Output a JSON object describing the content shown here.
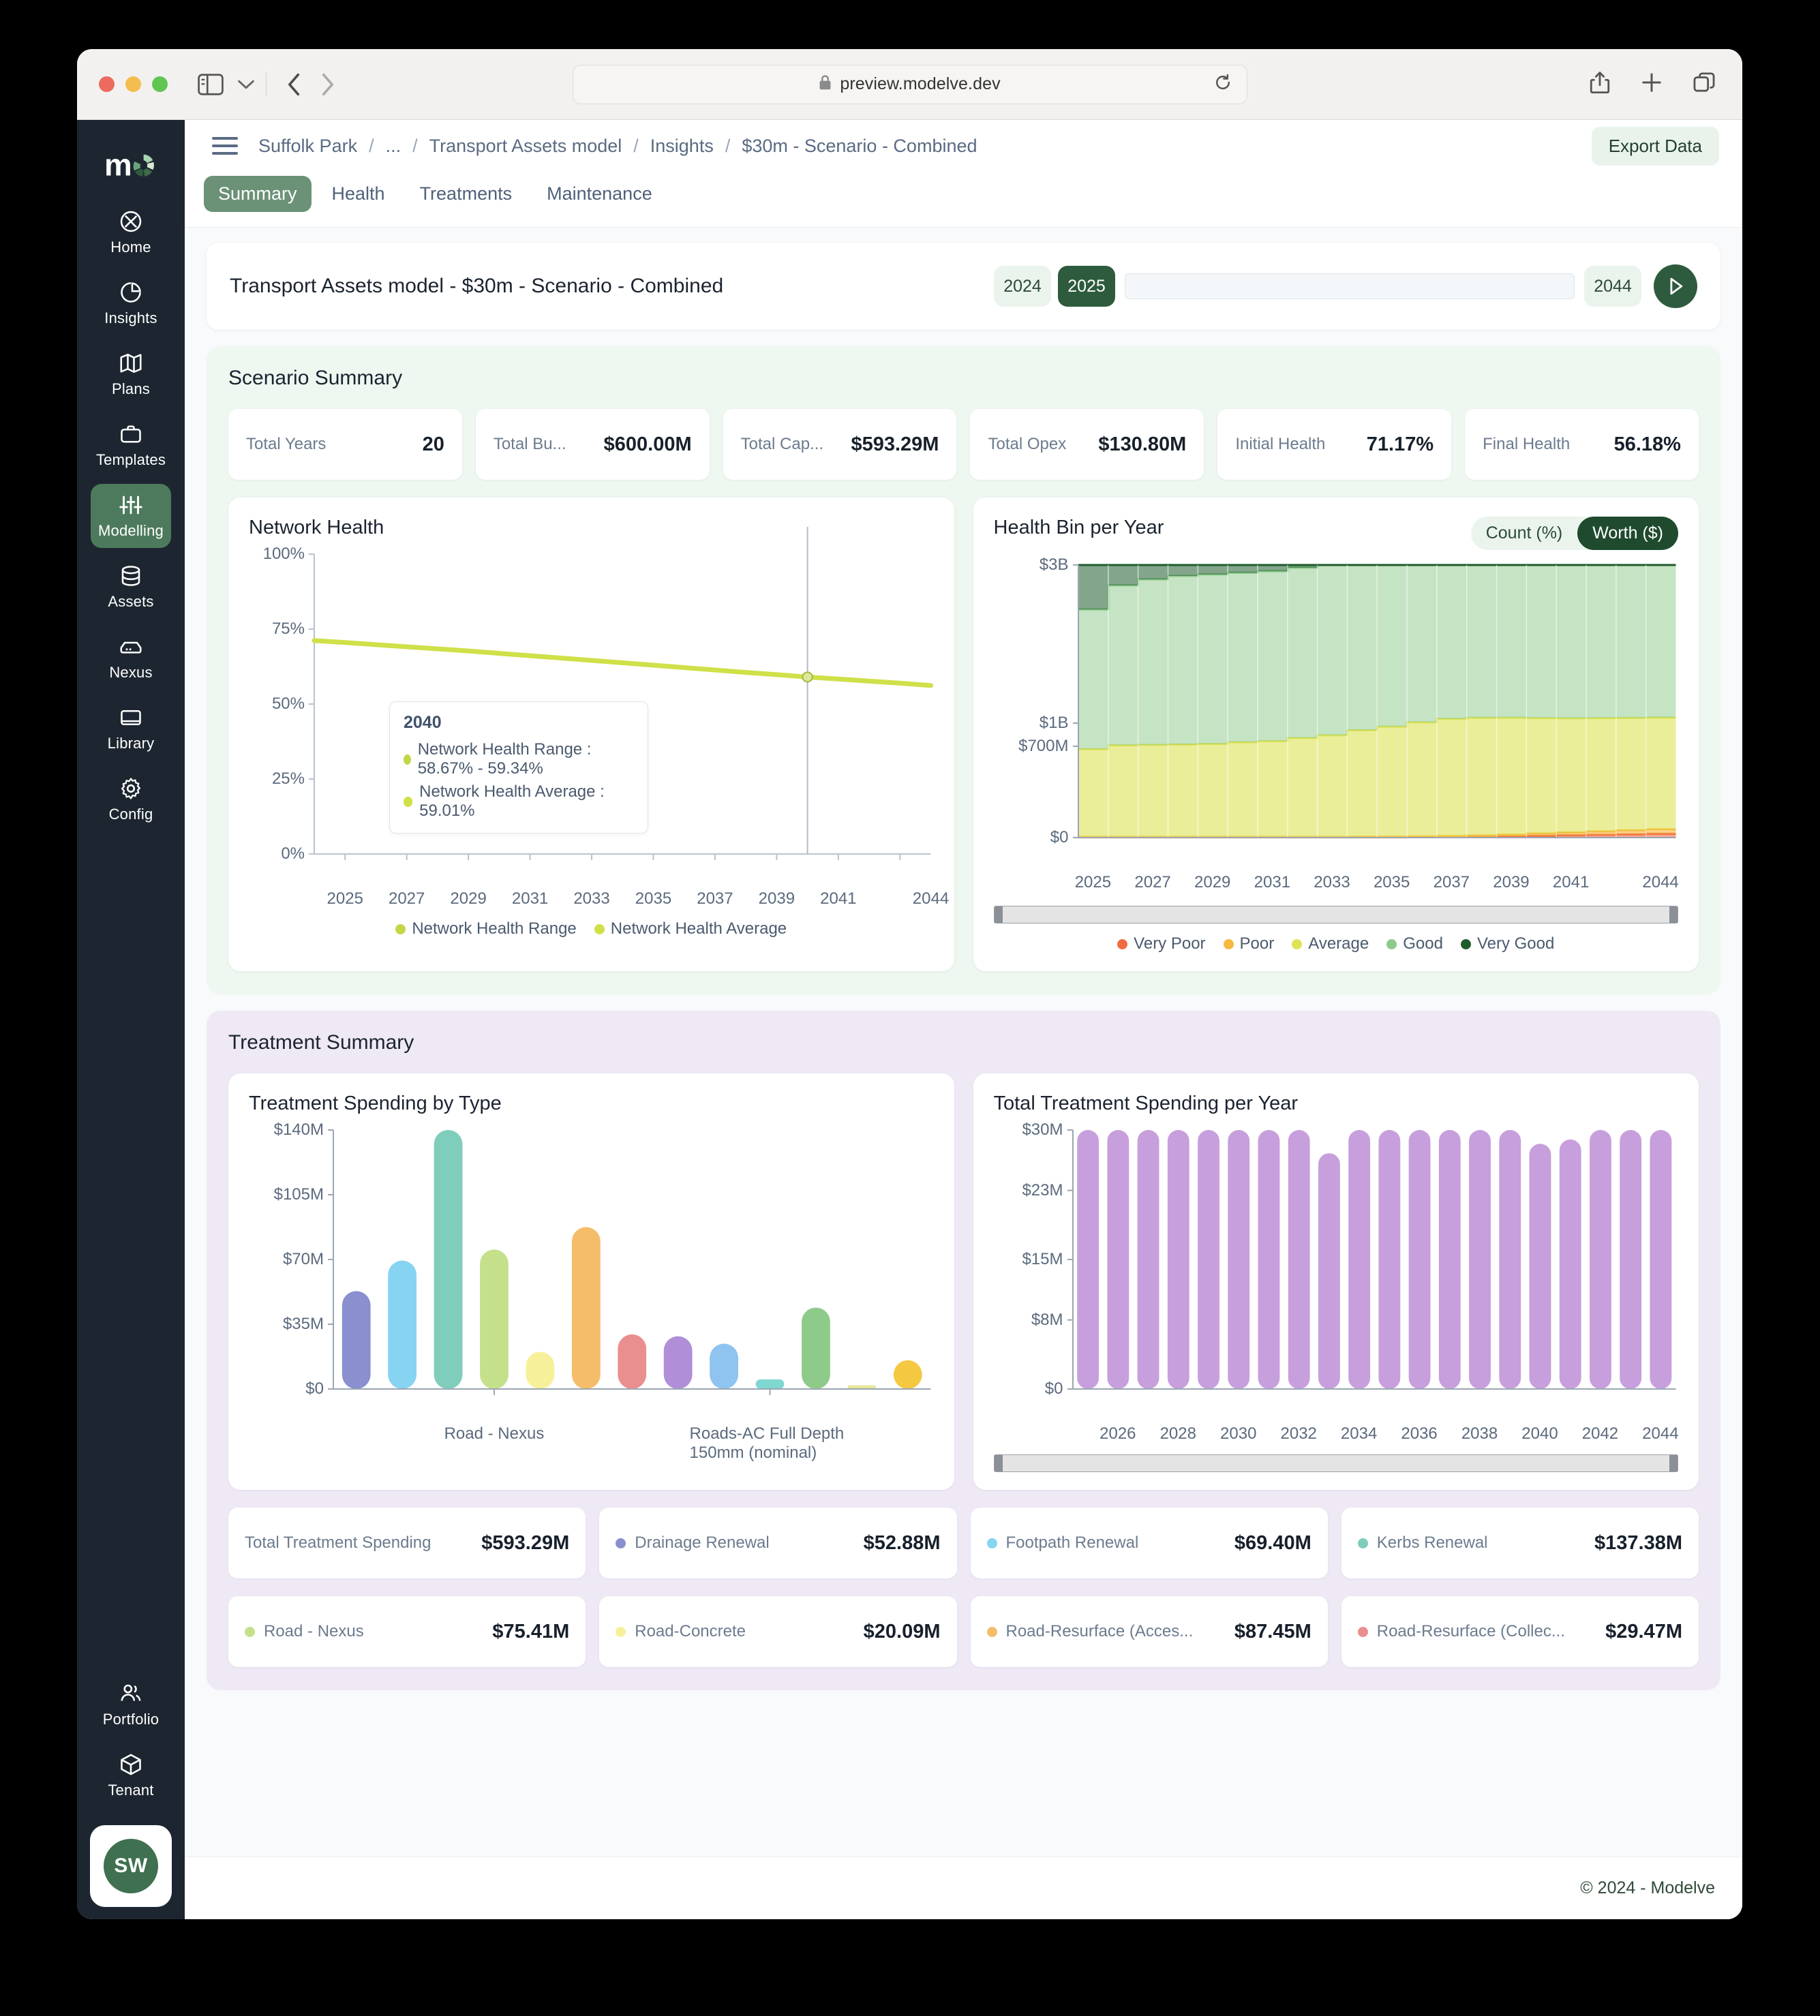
{
  "browser": {
    "url": "preview.modelve.dev",
    "lock_icon": "lock-icon",
    "reload_icon": "reload-icon",
    "share_icon": "share-icon",
    "new_tab_icon": "plus-icon",
    "tabs_icon": "tabs-overview-icon",
    "back_icon": "chevron-left-icon",
    "forward_icon": "chevron-right-icon",
    "sidebar_icon": "sidebar-toggle-icon",
    "sidebar_chevron": "chevron-down-icon"
  },
  "rail": {
    "logo": "modelve-logo",
    "items": [
      {
        "label": "Home",
        "icon": "home-aperture-icon",
        "active": false
      },
      {
        "label": "Insights",
        "icon": "pie-chart-icon",
        "active": false
      },
      {
        "label": "Plans",
        "icon": "map-icon",
        "active": false
      },
      {
        "label": "Templates",
        "icon": "briefcase-icon",
        "active": false
      },
      {
        "label": "Modelling",
        "icon": "sliders-icon",
        "active": true
      },
      {
        "label": "Assets",
        "icon": "database-icon",
        "active": false
      },
      {
        "label": "Nexus",
        "icon": "server-icon",
        "active": false
      },
      {
        "label": "Library",
        "icon": "book-icon",
        "active": false
      },
      {
        "label": "Config",
        "icon": "gear-icon",
        "active": false
      }
    ],
    "bottom_items": [
      {
        "label": "Portfolio",
        "icon": "users-icon"
      },
      {
        "label": "Tenant",
        "icon": "cube-icon"
      }
    ],
    "avatar_initials": "SW"
  },
  "topbar": {
    "menu_icon": "hamburger-icon",
    "breadcrumb": [
      "Suffolk Park",
      "...",
      "Transport Assets model",
      "Insights",
      "$30m - Scenario - Combined"
    ],
    "export_label": "Export Data"
  },
  "tabs": [
    {
      "label": "Summary",
      "active": true
    },
    {
      "label": "Health",
      "active": false
    },
    {
      "label": "Treatments",
      "active": false
    },
    {
      "label": "Maintenance",
      "active": false
    }
  ],
  "title_bar": {
    "title": "Transport Assets model - $30m - Scenario - Combined",
    "start_year": "2024",
    "current_year": "2025",
    "end_year": "2044",
    "play_icon": "play-icon"
  },
  "scenario_summary": {
    "heading": "Scenario Summary",
    "stats": [
      {
        "label": "Total Years",
        "value": "20"
      },
      {
        "label": "Total Bu...",
        "value": "$600.00M"
      },
      {
        "label": "Total Cap...",
        "value": "$593.29M"
      },
      {
        "label": "Total Opex",
        "value": "$130.80M"
      },
      {
        "label": "Initial Health",
        "value": "71.17%"
      },
      {
        "label": "Final Health",
        "value": "56.18%"
      }
    ]
  },
  "treatment_summary": {
    "heading": "Treatment Summary",
    "cards": [
      {
        "label": "Total Treatment Spending",
        "value": "$593.29M",
        "color": null
      },
      {
        "label": "Drainage Renewal",
        "value": "$52.88M",
        "color": "#8a8fd0"
      },
      {
        "label": "Footpath Renewal",
        "value": "$69.40M",
        "color": "#87d3f2"
      },
      {
        "label": "Kerbs Renewal",
        "value": "$137.38M",
        "color": "#7fcdbb"
      },
      {
        "label": "Road - Nexus",
        "value": "$75.41M",
        "color": "#c5e08b"
      },
      {
        "label": "Road-Concrete",
        "value": "$20.09M",
        "color": "#f7f09a"
      },
      {
        "label": "Road-Resurface (Acces...",
        "value": "$87.45M",
        "color": "#f5bc6a"
      },
      {
        "label": "Road-Resurface (Collec...",
        "value": "$29.47M",
        "color": "#e98f8f"
      }
    ]
  },
  "footer": {
    "copyright": "© 2024 - Modelve"
  },
  "chart_data": [
    {
      "id": "network-health",
      "type": "line",
      "title": "Network Health",
      "xlabel": "",
      "ylabel": "",
      "ylim": [
        0,
        100
      ],
      "ytick_labels": [
        "0%",
        "25%",
        "50%",
        "75%",
        "100%"
      ],
      "ytick_values": [
        0,
        25,
        50,
        75,
        100
      ],
      "x": [
        2024,
        2025,
        2026,
        2027,
        2028,
        2029,
        2030,
        2031,
        2032,
        2033,
        2034,
        2035,
        2036,
        2037,
        2038,
        2039,
        2040,
        2041,
        2042,
        2043,
        2044
      ],
      "xtick_labels": [
        "2025",
        "2027",
        "2029",
        "2031",
        "2033",
        "2035",
        "2037",
        "2039",
        "2041",
        "2044"
      ],
      "grid": false,
      "legend": [
        "Network Health Range",
        "Network Health Average"
      ],
      "legend_position": "bottom",
      "series": [
        {
          "name": "Network Health Range",
          "color": "#c4d646",
          "lower": [
            70.6,
            70.0,
            69.3,
            68.6,
            67.9,
            67.2,
            66.4,
            65.6,
            64.8,
            64.0,
            63.2,
            62.4,
            61.6,
            60.8,
            60.0,
            59.3,
            58.67,
            58.0,
            57.3,
            56.6,
            55.8
          ],
          "upper": [
            71.6,
            71.0,
            70.3,
            69.6,
            68.9,
            68.2,
            67.4,
            66.6,
            65.9,
            65.1,
            64.3,
            63.5,
            62.7,
            61.9,
            61.1,
            60.3,
            59.34,
            58.7,
            58.0,
            57.3,
            56.6
          ]
        },
        {
          "name": "Network Health Average",
          "color": "#cfe048",
          "values": [
            71.17,
            70.5,
            69.8,
            69.1,
            68.4,
            67.7,
            66.9,
            66.1,
            65.35,
            64.55,
            63.75,
            62.95,
            62.15,
            61.35,
            60.55,
            59.8,
            59.01,
            58.35,
            57.65,
            56.95,
            56.18
          ]
        }
      ],
      "tooltip": {
        "year": "2040",
        "rows": [
          {
            "label": "Network Health Range : 58.67% - 59.34%",
            "color": "#c4d646"
          },
          {
            "label": "Network Health Average : 59.01%",
            "color": "#cfe048"
          }
        ]
      }
    },
    {
      "id": "health-bin-per-year",
      "type": "area",
      "title": "Health Bin per Year",
      "toggle_options": [
        "Count (%)",
        "Worth ($)"
      ],
      "toggle_selected": "Worth ($)",
      "xlabel": "",
      "ylabel": "",
      "ylim": [
        0,
        3000
      ],
      "ytick_labels": [
        "$0",
        "$700M",
        "$1B",
        "$3B"
      ],
      "ytick_values": [
        0,
        700,
        1000,
        3000
      ],
      "x": [
        2025,
        2026,
        2027,
        2028,
        2029,
        2030,
        2031,
        2032,
        2033,
        2034,
        2035,
        2036,
        2037,
        2038,
        2039,
        2040,
        2041,
        2042,
        2043,
        2044
      ],
      "xtick_labels": [
        "2025",
        "2027",
        "2029",
        "2031",
        "2033",
        "2035",
        "2037",
        "2039",
        "2041",
        "2044"
      ],
      "grid": false,
      "legend": [
        "Very Poor",
        "Poor",
        "Average",
        "Good",
        "Very Good"
      ],
      "legend_position": "bottom",
      "series": [
        {
          "name": "Very Poor",
          "color": "#ef6c42",
          "values": [
            2,
            2,
            2,
            2,
            2,
            2,
            2,
            2,
            2,
            2,
            2,
            3,
            4,
            6,
            9,
            14,
            18,
            22,
            26,
            30
          ]
        },
        {
          "name": "Poor",
          "color": "#f6b83f",
          "values": [
            4,
            4,
            4,
            4,
            4,
            4,
            4,
            4,
            4,
            5,
            6,
            7,
            9,
            11,
            14,
            18,
            22,
            26,
            30,
            34
          ]
        },
        {
          "name": "Average",
          "color": "#dde354",
          "values": [
            672,
            706,
            712,
            716,
            724,
            746,
            760,
            800,
            836,
            900,
            946,
            1000,
            1040,
            1050,
            1045,
            1030,
            1020,
            1014,
            1010,
            1005
          ]
        },
        {
          "name": "Good",
          "color": "#8cc98a",
          "values": [
            1760,
            2030,
            2100,
            2140,
            2150,
            2150,
            2155,
            2160,
            2170,
            2180,
            2190,
            2195,
            2200,
            2205,
            2215,
            2225,
            2230,
            2235,
            2240,
            2245
          ]
        },
        {
          "name": "Very Good",
          "color": "#1e5c2b",
          "values": [
            3000,
            3000,
            3000,
            3000,
            3000,
            3000,
            3000,
            3000,
            3000,
            3000,
            3000,
            3000,
            3000,
            3000,
            3000,
            3000,
            3000,
            3000,
            3000,
            3000
          ]
        }
      ]
    },
    {
      "id": "treatment-spending-by-type",
      "type": "bar",
      "title": "Treatment Spending by Type",
      "xlabel": "",
      "ylabel": "",
      "ylim": [
        0,
        140
      ],
      "ytick_labels": [
        "$0",
        "$35M",
        "$70M",
        "$105M",
        "$140M"
      ],
      "ytick_values": [
        0,
        35,
        70,
        105,
        140
      ],
      "xtick_labels": [
        "Road - Nexus",
        "Roads-AC Full Depth 150mm (nominal)"
      ],
      "grid": false,
      "categories": [
        "b1",
        "b2",
        "b3",
        "b4",
        "b5",
        "b6",
        "b7",
        "b8",
        "b9",
        "b10",
        "b11",
        "b12",
        "b13"
      ],
      "values": [
        52.9,
        69.4,
        140.0,
        75.4,
        20.1,
        87.5,
        29.5,
        28.5,
        24.5,
        5.2,
        44.0,
        2.0,
        15.5
      ],
      "colors": [
        "#8a8fd0",
        "#87d3f2",
        "#7fcdbb",
        "#c5e08b",
        "#f7f09a",
        "#f5bc6a",
        "#e98f8f",
        "#b08fd8",
        "#8fc3f0",
        "#7fd8d0",
        "#8ecb8a",
        "#e8e79a",
        "#f5c842"
      ]
    },
    {
      "id": "total-treatment-spending-per-year",
      "type": "bar",
      "title": "Total Treatment Spending per Year",
      "xlabel": "",
      "ylabel": "",
      "ylim": [
        0,
        30
      ],
      "ytick_labels": [
        "$0",
        "$8M",
        "$15M",
        "$23M",
        "$30M"
      ],
      "ytick_values": [
        0,
        8,
        15,
        23,
        30
      ],
      "categories": [
        2025,
        2026,
        2027,
        2028,
        2029,
        2030,
        2031,
        2032,
        2033,
        2034,
        2035,
        2036,
        2037,
        2038,
        2039,
        2040,
        2041,
        2042,
        2043,
        2044
      ],
      "xtick_labels": [
        "2026",
        "2028",
        "2030",
        "2032",
        "2034",
        "2036",
        "2038",
        "2040",
        "2042",
        "2044"
      ],
      "values": [
        30,
        30,
        30,
        30,
        30,
        30,
        30,
        30,
        27.3,
        30,
        30,
        30,
        30,
        30,
        30,
        28.4,
        28.9,
        30,
        30,
        30
      ],
      "bar_color": "#c79fdc",
      "grid": false
    }
  ]
}
